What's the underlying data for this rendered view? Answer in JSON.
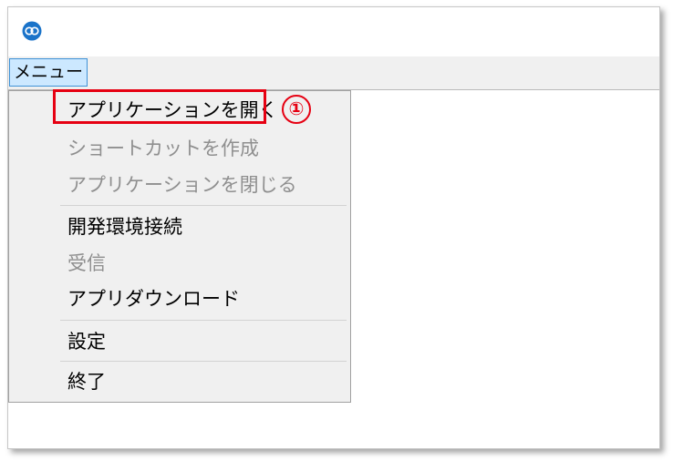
{
  "app": {
    "icon": "app-logo-icon",
    "accent": "#1a73c9"
  },
  "menubar": {
    "menu_label": "メニュー"
  },
  "menu": {
    "items": [
      {
        "label": "アプリケーションを開く",
        "enabled": true
      },
      {
        "label": "ショートカットを作成",
        "enabled": false
      },
      {
        "label": "アプリケーションを閉じる",
        "enabled": false
      },
      {
        "label": "開発環境接続",
        "enabled": true
      },
      {
        "label": "受信",
        "enabled": false
      },
      {
        "label": "アプリダウンロード",
        "enabled": true
      },
      {
        "label": "設定",
        "enabled": true
      },
      {
        "label": "終了",
        "enabled": true
      }
    ]
  },
  "annotation": {
    "step": "①",
    "color": "#e60012"
  }
}
